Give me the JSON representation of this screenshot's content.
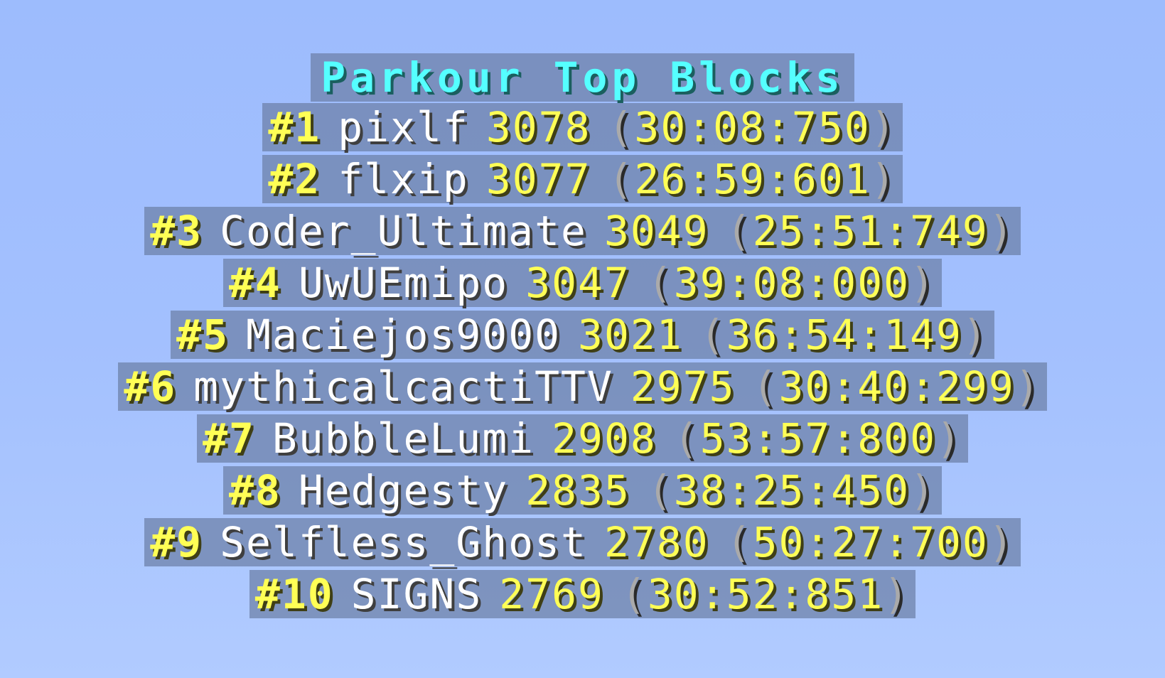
{
  "scoreboard": {
    "title": "Parkour Top Blocks",
    "entries": [
      {
        "rank": "#1",
        "name": "pixlf",
        "score": "3078",
        "open": "(",
        "time": "30:08:750",
        "close": ")"
      },
      {
        "rank": "#2",
        "name": "flxip",
        "score": "3077",
        "open": "(",
        "time": "26:59:601",
        "close": ")"
      },
      {
        "rank": "#3",
        "name": "Coder_Ultimate",
        "score": "3049",
        "open": "(",
        "time": "25:51:749",
        "close": ")"
      },
      {
        "rank": "#4",
        "name": "UwUEmipo",
        "score": "3047",
        "open": "(",
        "time": "39:08:000",
        "close": ")"
      },
      {
        "rank": "#5",
        "name": "Maciejos9000",
        "score": "3021",
        "open": "(",
        "time": "36:54:149",
        "close": ")"
      },
      {
        "rank": "#6",
        "name": "mythicalcactiTTV",
        "score": "2975",
        "open": "(",
        "time": "30:40:299",
        "close": ")"
      },
      {
        "rank": "#7",
        "name": "BubbleLumi",
        "score": "2908",
        "open": "(",
        "time": "53:57:800",
        "close": ")"
      },
      {
        "rank": "#8",
        "name": "Hedgesty",
        "score": "2835",
        "open": "(",
        "time": "38:25:450",
        "close": ")"
      },
      {
        "rank": "#9",
        "name": "Selfless_Ghost",
        "score": "2780",
        "open": "(",
        "time": "50:27:700",
        "close": ")"
      },
      {
        "rank": "#10",
        "name": "SIGNS",
        "score": "2769",
        "open": "(",
        "time": "30:52:851",
        "close": ")"
      }
    ]
  },
  "colors": {
    "title": "#55ffff",
    "rank_and_score": "#ffff55",
    "name": "#ffffff",
    "paren": "#aaaaaa",
    "plate": "#6e82aa",
    "sky": "#a3c0fe"
  }
}
